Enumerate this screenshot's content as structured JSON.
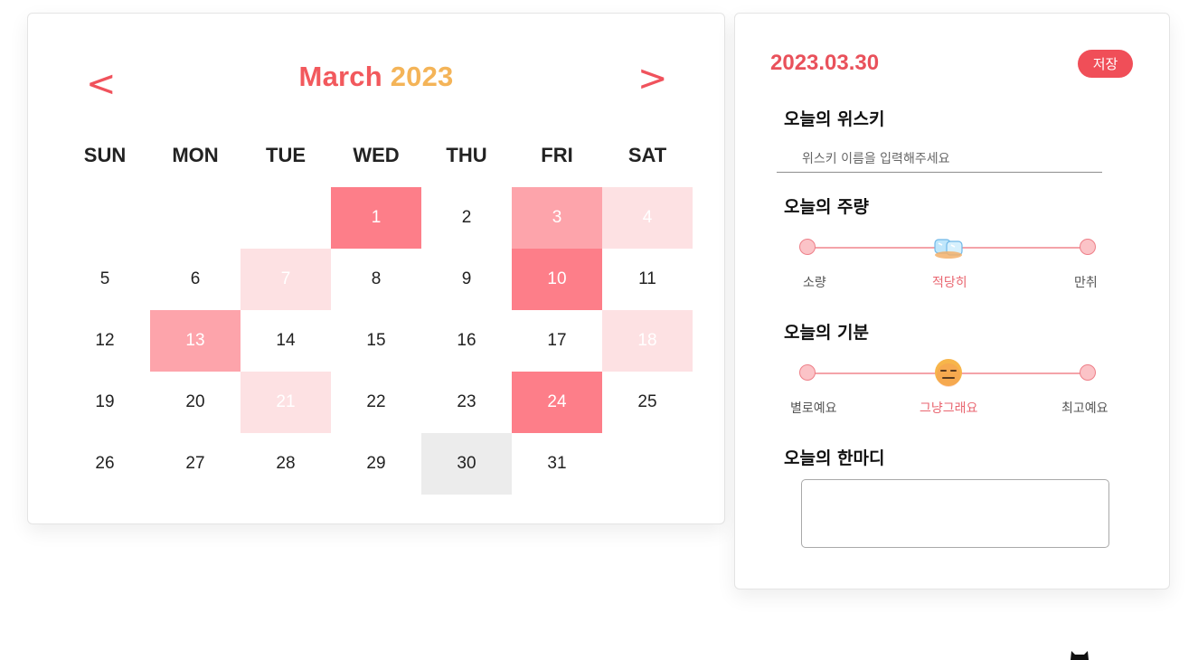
{
  "calendar": {
    "prev": "<",
    "next": ">",
    "month": "March",
    "year": "2023",
    "weekdays": [
      "SUN",
      "MON",
      "TUE",
      "WED",
      "THU",
      "FRI",
      "SAT"
    ],
    "days": [
      {
        "n": "1",
        "col": 4,
        "row": 1,
        "level": 3
      },
      {
        "n": "2",
        "col": 5,
        "row": 1,
        "level": 0
      },
      {
        "n": "3",
        "col": 6,
        "row": 1,
        "level": 2
      },
      {
        "n": "4",
        "col": 7,
        "row": 1,
        "level": 1
      },
      {
        "n": "5",
        "col": 1,
        "row": 2,
        "level": 0
      },
      {
        "n": "6",
        "col": 2,
        "row": 2,
        "level": 0
      },
      {
        "n": "7",
        "col": 3,
        "row": 2,
        "level": 1
      },
      {
        "n": "8",
        "col": 4,
        "row": 2,
        "level": 0
      },
      {
        "n": "9",
        "col": 5,
        "row": 2,
        "level": 0
      },
      {
        "n": "10",
        "col": 6,
        "row": 2,
        "level": 3
      },
      {
        "n": "11",
        "col": 7,
        "row": 2,
        "level": 0
      },
      {
        "n": "12",
        "col": 1,
        "row": 3,
        "level": 0
      },
      {
        "n": "13",
        "col": 2,
        "row": 3,
        "level": 2
      },
      {
        "n": "14",
        "col": 3,
        "row": 3,
        "level": 0
      },
      {
        "n": "15",
        "col": 4,
        "row": 3,
        "level": 0
      },
      {
        "n": "16",
        "col": 5,
        "row": 3,
        "level": 0
      },
      {
        "n": "17",
        "col": 6,
        "row": 3,
        "level": 0
      },
      {
        "n": "18",
        "col": 7,
        "row": 3,
        "level": 1
      },
      {
        "n": "19",
        "col": 1,
        "row": 4,
        "level": 0
      },
      {
        "n": "20",
        "col": 2,
        "row": 4,
        "level": 0
      },
      {
        "n": "21",
        "col": 3,
        "row": 4,
        "level": 1
      },
      {
        "n": "22",
        "col": 4,
        "row": 4,
        "level": 0
      },
      {
        "n": "23",
        "col": 5,
        "row": 4,
        "level": 0
      },
      {
        "n": "24",
        "col": 6,
        "row": 4,
        "level": 3
      },
      {
        "n": "25",
        "col": 7,
        "row": 4,
        "level": 0
      },
      {
        "n": "26",
        "col": 1,
        "row": 5,
        "level": 0
      },
      {
        "n": "27",
        "col": 2,
        "row": 5,
        "level": 0
      },
      {
        "n": "28",
        "col": 3,
        "row": 5,
        "level": 0
      },
      {
        "n": "29",
        "col": 4,
        "row": 5,
        "level": 0
      },
      {
        "n": "30",
        "col": 5,
        "row": 5,
        "level": 0,
        "today": true
      },
      {
        "n": "31",
        "col": 6,
        "row": 5,
        "level": 0
      }
    ]
  },
  "diary": {
    "date": "2023.03.30",
    "save_label": "저장",
    "whisky": {
      "label": "오늘의 위스키",
      "placeholder": "위스키 이름을 입력해주세요",
      "value": ""
    },
    "amount": {
      "label": "오늘의 주량",
      "options": [
        "소량",
        "적당히",
        "만취"
      ],
      "selected": 1,
      "icon": "ice-cubes-icon"
    },
    "mood": {
      "label": "오늘의 기분",
      "options": [
        "별로예요",
        "그냥그래요",
        "최고예요"
      ],
      "selected": 1,
      "icon": "neutral-face-icon"
    },
    "comment": {
      "label": "오늘의 한마디",
      "value": ""
    }
  },
  "colors": {
    "accent": "#f04e58",
    "level1": "#fde1e3",
    "level2": "#fda4ab",
    "level3": "#fd7e89",
    "today": "#ececec",
    "year": "#f4b458"
  }
}
